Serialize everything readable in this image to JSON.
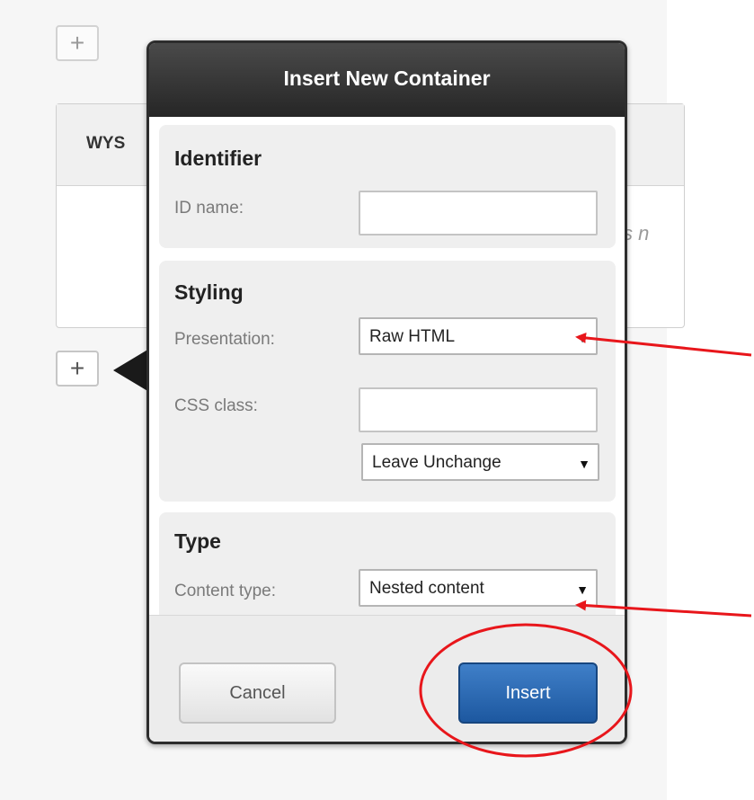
{
  "background": {
    "top_plus": "+",
    "side_plus": "+",
    "panel_header_partial": "WYS",
    "panel_body_partial": "s n"
  },
  "dialog": {
    "title": "Insert New Container",
    "identifier": {
      "heading": "Identifier",
      "id_label": "ID name:",
      "id_value": ""
    },
    "styling": {
      "heading": "Styling",
      "presentation_label": "Presentation:",
      "presentation_value": "Raw HTML",
      "css_class_label": "CSS class:",
      "css_class_value": "",
      "css_mode_value": "Leave Unchange"
    },
    "type": {
      "heading": "Type",
      "content_type_label": "Content type:",
      "content_type_value": "Nested content"
    },
    "buttons": {
      "cancel": "Cancel",
      "insert": "Insert"
    }
  },
  "icons": {
    "dropdown_arrow": "▼"
  },
  "colors": {
    "annotation": "#e8161b",
    "insert_button": "#2563ab",
    "dialog_header": "#2f2f2f"
  }
}
